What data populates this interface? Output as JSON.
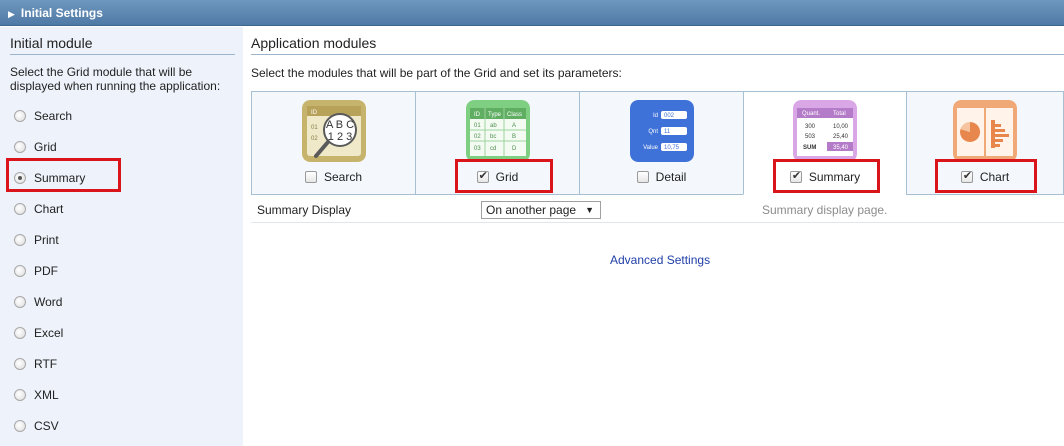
{
  "header": {
    "title": "Initial Settings"
  },
  "left": {
    "title": "Initial module",
    "description": "Select the Grid module that will be displayed when running the application:",
    "options": [
      {
        "label": "Search",
        "checked": false
      },
      {
        "label": "Grid",
        "checked": false
      },
      {
        "label": "Summary",
        "checked": true
      },
      {
        "label": "Chart",
        "checked": false
      },
      {
        "label": "Print",
        "checked": false
      },
      {
        "label": "PDF",
        "checked": false
      },
      {
        "label": "Word",
        "checked": false
      },
      {
        "label": "Excel",
        "checked": false
      },
      {
        "label": "RTF",
        "checked": false
      },
      {
        "label": "XML",
        "checked": false
      },
      {
        "label": "CSV",
        "checked": false
      }
    ]
  },
  "right": {
    "title": "Application modules",
    "description": "Select the modules that will be part of the Grid and set its parameters:",
    "modules": [
      {
        "label": "Search",
        "checked": false,
        "icon": "search-icon"
      },
      {
        "label": "Grid",
        "checked": true,
        "icon": "grid-icon"
      },
      {
        "label": "Detail",
        "checked": false,
        "icon": "detail-icon"
      },
      {
        "label": "Summary",
        "checked": true,
        "icon": "summary-icon"
      },
      {
        "label": "Chart",
        "checked": true,
        "icon": "chart-icon"
      }
    ],
    "summary_display_label": "Summary Display",
    "summary_display_value": "On another page",
    "summary_display_hint": "Summary display page.",
    "advanced_settings": "Advanced Settings"
  },
  "icon_text": {
    "search": {
      "col": "ID",
      "rows": [
        "01",
        "02"
      ],
      "letters": "A B C",
      "digits": "1 2 3"
    },
    "grid": {
      "headers": [
        "ID",
        "Type",
        "Class"
      ],
      "rows": [
        [
          "01",
          "ab",
          "A"
        ],
        [
          "02",
          "bc",
          "B"
        ],
        [
          "03",
          "cd",
          "D"
        ]
      ]
    },
    "detail": {
      "fields": [
        [
          "Id",
          "002"
        ],
        [
          "Qnt",
          "11"
        ],
        [
          "Value",
          "10,75"
        ]
      ]
    },
    "summary": {
      "headers": [
        "Quant.",
        "Total"
      ],
      "rows": [
        [
          "300",
          "10,00"
        ],
        [
          "503",
          "25,40"
        ],
        [
          "SUM",
          "35,40"
        ]
      ]
    }
  },
  "colors": {
    "highlight": "#d9141b",
    "titlebar": "#5a84ae",
    "link": "#1f3ea8"
  }
}
